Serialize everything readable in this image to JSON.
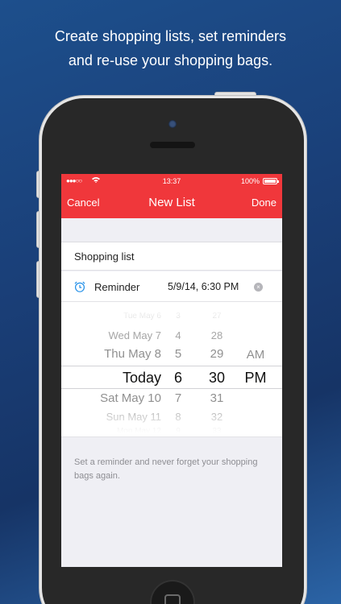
{
  "promo": {
    "line1": "Create shopping lists, set reminders",
    "line2": "and re-use your shopping bags."
  },
  "status_bar": {
    "carrier": "●●●○○",
    "wifi": "wifi-icon",
    "time": "13:37",
    "battery": "100%"
  },
  "nav": {
    "cancel": "Cancel",
    "title": "New List",
    "done": "Done",
    "color": "#f0373b"
  },
  "form": {
    "list_name": "Shopping list",
    "reminder_label": "Reminder",
    "reminder_value": "5/9/14, 6:30 PM",
    "clear_icon": "×"
  },
  "picker": {
    "dates": [
      "Tue May 6",
      "Wed May 7",
      "Thu May 8",
      "Today",
      "Sat May 10",
      "Sun May 11",
      "Mon May 12"
    ],
    "hours": [
      "3",
      "4",
      "5",
      "6",
      "7",
      "8",
      "9"
    ],
    "minutes": [
      "27",
      "28",
      "29",
      "30",
      "31",
      "32",
      "33"
    ],
    "ampm": [
      "AM",
      "PM"
    ]
  },
  "footer": {
    "note": "Set a reminder and never forget your shopping bags again."
  }
}
